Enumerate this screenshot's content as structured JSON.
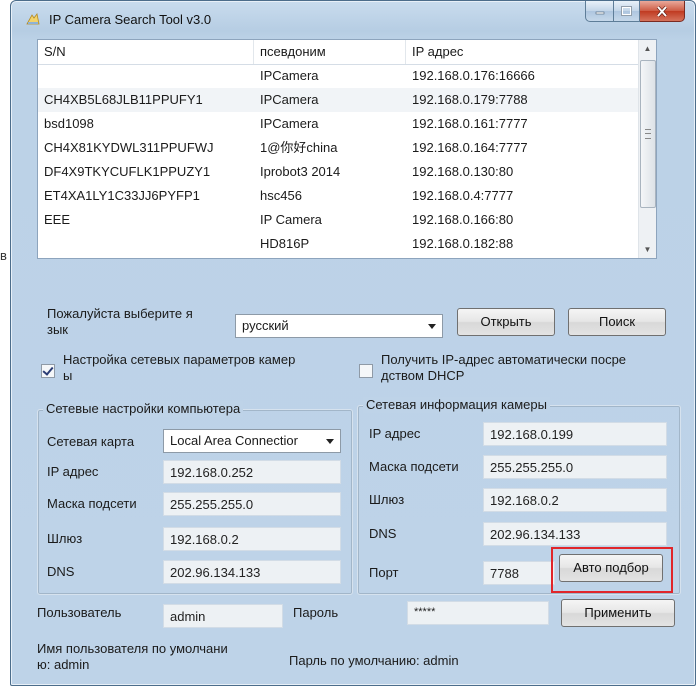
{
  "window": {
    "title": "IP Camera Search Tool  v3.0"
  },
  "list": {
    "columns": [
      "S/N",
      "псевдоним",
      "IP адрес"
    ],
    "rows": [
      [
        "",
        "IPCamera",
        "192.168.0.176:16666"
      ],
      [
        "CH4XB5L68JLB11PPUFY1",
        "IPCamera",
        "192.168.0.179:7788"
      ],
      [
        "bsd1098",
        "IPCamera",
        "192.168.0.161:7777"
      ],
      [
        "CH4X81KYDWL311PPUFWJ",
        "1@你好china",
        "192.168.0.164:7777"
      ],
      [
        "DF4X9TKYCUFLK1PPUZY1",
        "Iprobot3 2014",
        "192.168.0.130:80"
      ],
      [
        "ET4XA1LY1C33JJ6PYFP1",
        "hsc456",
        "192.168.0.4:7777"
      ],
      [
        "EEE",
        "IP Camera",
        "192.168.0.166:80"
      ],
      [
        "",
        "HD816P",
        "192.168.0.182:88"
      ]
    ]
  },
  "language": {
    "label_line1": "Пожалуйста выберите я",
    "label_line2": "зык",
    "selected": "русский"
  },
  "buttons": {
    "open": "Открыть",
    "search": "Поиск",
    "auto": "Авто подбор",
    "apply": "Применить"
  },
  "options": {
    "network_setup_line1": "Настройка сетевых параметров камер",
    "network_setup_line2": "ы",
    "dhcp_line1": "Получить IP-адрес автоматически посре",
    "dhcp_line2": "дством DHCP"
  },
  "pc_network": {
    "title": "Сетевые настройки компьютера",
    "adapter_label": "Сетевая карта",
    "adapter_value": "Local Area Connectior",
    "ip_label": "IP адрес",
    "ip_value": "192.168.0.252",
    "mask_label": "Маска подсети",
    "mask_value": "255.255.255.0",
    "gateway_label": "Шлюз",
    "gateway_value": "192.168.0.2",
    "dns_label": "DNS",
    "dns_value": "202.96.134.133"
  },
  "camera_network": {
    "title": "Сетевая информация камеры",
    "ip_label": "IP адрес",
    "ip_value": "192.168.0.199",
    "mask_label": "Маска подсети",
    "mask_value": "255.255.255.0",
    "gateway_label": "Шлюз",
    "gateway_value": "192.168.0.2",
    "dns_label": "DNS",
    "dns_value": "202.96.134.133",
    "port_label": "Порт",
    "port_value": "7788"
  },
  "account": {
    "user_label": "Пользователь",
    "user_value": "admin",
    "password_label": "Пароль",
    "password_value": "*****",
    "default_user_line1": "Имя пользователя по умолчани",
    "default_user_line2": "ю: admin",
    "default_password": "Парль по умолчанию: admin"
  },
  "edge_fragment": "в"
}
